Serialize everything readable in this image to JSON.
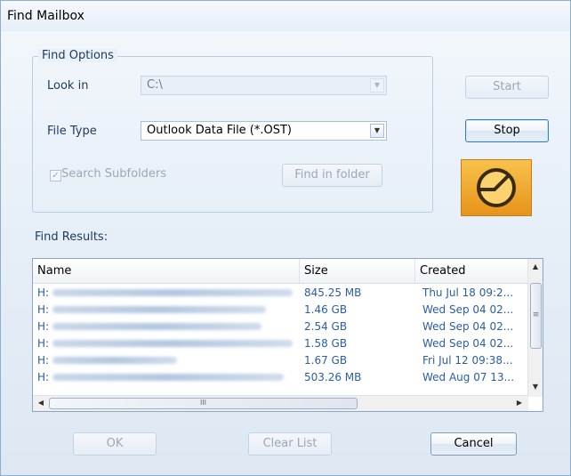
{
  "window": {
    "title": "Find Mailbox"
  },
  "find_options": {
    "legend": "Find Options",
    "look_in_label": "Look in",
    "look_in_value": "C:\\",
    "file_type_label": "File Type",
    "file_type_value": "Outlook Data File (*.OST)",
    "search_subfolders_label": "Search Subfolders",
    "search_subfolders_checked": true,
    "find_in_folder_label": "Find in folder"
  },
  "actions": {
    "start_label": "Start",
    "stop_label": "Stop"
  },
  "results": {
    "label": "Find Results:",
    "columns": [
      "Name",
      "Size",
      "Created"
    ],
    "rows": [
      {
        "name": "H:",
        "size": "845.25 MB",
        "created": "Thu Jul 18 09:2..."
      },
      {
        "name": "H:",
        "size": "1.46 GB",
        "created": "Wed Sep 04 02..."
      },
      {
        "name": "H:",
        "size": "2.54 GB",
        "created": "Wed Sep 04 02..."
      },
      {
        "name": "H:",
        "size": "1.58 GB",
        "created": "Wed Sep 04 02..."
      },
      {
        "name": "H:",
        "size": "1.67 GB",
        "created": "Fri Jul 12 09:38..."
      },
      {
        "name": "H:",
        "size": "503.26 MB",
        "created": "Wed Aug 07 13..."
      }
    ],
    "hscroll_grip": "III",
    "vscroll_grip": "≡"
  },
  "footer": {
    "ok_label": "OK",
    "clear_list_label": "Clear List",
    "cancel_label": "Cancel"
  },
  "icons": {
    "logo": "outlook-clock-logo",
    "dropdown": "chevron-down-icon",
    "scroll_up": "scroll-up-icon",
    "scroll_down": "scroll-down-icon",
    "scroll_left": "scroll-left-icon",
    "scroll_right": "scroll-right-icon"
  },
  "colors": {
    "accent": "#3c7fb1",
    "logo_orange": "#f0a42a",
    "link_text": "#2a5da8"
  }
}
